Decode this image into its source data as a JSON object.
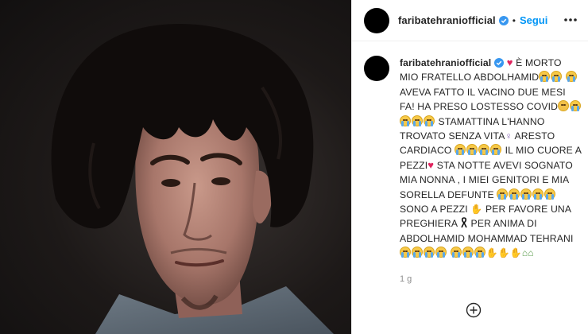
{
  "post": {
    "username": "faribatehraniofficial",
    "follow_label": "Segui",
    "separator": "•",
    "time_ago": "1 g"
  },
  "caption": {
    "username": "faribatehraniofficial",
    "segments": {
      "s1": " È MORTO MIO FRATELLO ABDOLHAMID",
      "s2": " AVEVA FATTO IL VACINO DUE MESI FA! HA PRESO LOSTESSO COVID",
      "s3": " STAMATTINA L'HANNO TROVATO SENZA VITA",
      "s4": " ARESTO CARDIACO ",
      "s5": " IL MIO CUORE A PEZZI",
      "s6": " STA NOTTE AVEVI SOGNATO MIA NONNA , I MIEI GENITORI E MIA SORELLA DEFUNTE ",
      "s7": " SONO A PEZZI ",
      "s8": " PER FAVORE UNA PREGHIERA ",
      "s9": " PER ANIMA DI ABDOLHAMID MOHAMMAD TEHRANI "
    }
  },
  "icons": {
    "verified": "verified-badge-icon",
    "more": "more-options-icon",
    "add": "add-circle-icon",
    "heart": "red-heart-emoji",
    "crying": "crying-face-emoji",
    "flushed": "flushed-face-emoji",
    "pray": "folded-hands-emoji",
    "ribbon": "black-ribbon-emoji",
    "house": "house-emoji"
  },
  "colors": {
    "accent": "#0095f6",
    "text": "#262626",
    "muted": "#8e8e8e",
    "heart": "#e0245e"
  }
}
